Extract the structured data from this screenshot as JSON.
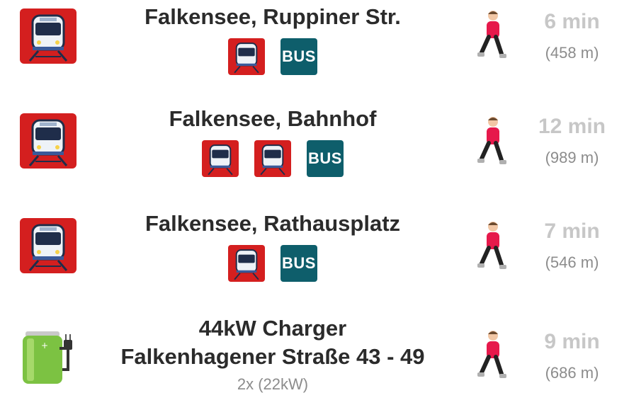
{
  "places": [
    {
      "icon": "train-icon",
      "title_lines": [
        "Falkensee, Ruppiner Str."
      ],
      "modes": [
        "train",
        "bus"
      ],
      "mode_labels": {
        "bus": "BUS"
      },
      "subtitle": "",
      "time": "6 min",
      "distance": "(458 m)"
    },
    {
      "icon": "train-icon",
      "title_lines": [
        "Falkensee, Bahnhof"
      ],
      "modes": [
        "train",
        "train",
        "bus"
      ],
      "mode_labels": {
        "bus": "BUS"
      },
      "subtitle": "",
      "time": "12 min",
      "distance": "(989 m)"
    },
    {
      "icon": "train-icon",
      "title_lines": [
        "Falkensee, Rathausplatz"
      ],
      "modes": [
        "train",
        "bus"
      ],
      "mode_labels": {
        "bus": "BUS"
      },
      "subtitle": "",
      "time": "7 min",
      "distance": "(546 m)"
    },
    {
      "icon": "battery-charger-icon",
      "title_lines": [
        "44kW Charger",
        "Falkenhagener Straße 43 - 49"
      ],
      "modes": [],
      "subtitle": "2x (22kW)",
      "time": "9 min",
      "distance": "(686 m)"
    }
  ],
  "colors": {
    "train_red": "#d41f1f",
    "bus_teal": "#0e5e6b",
    "time_gray": "#c7c7c7",
    "text_dark": "#2b2b2b"
  }
}
